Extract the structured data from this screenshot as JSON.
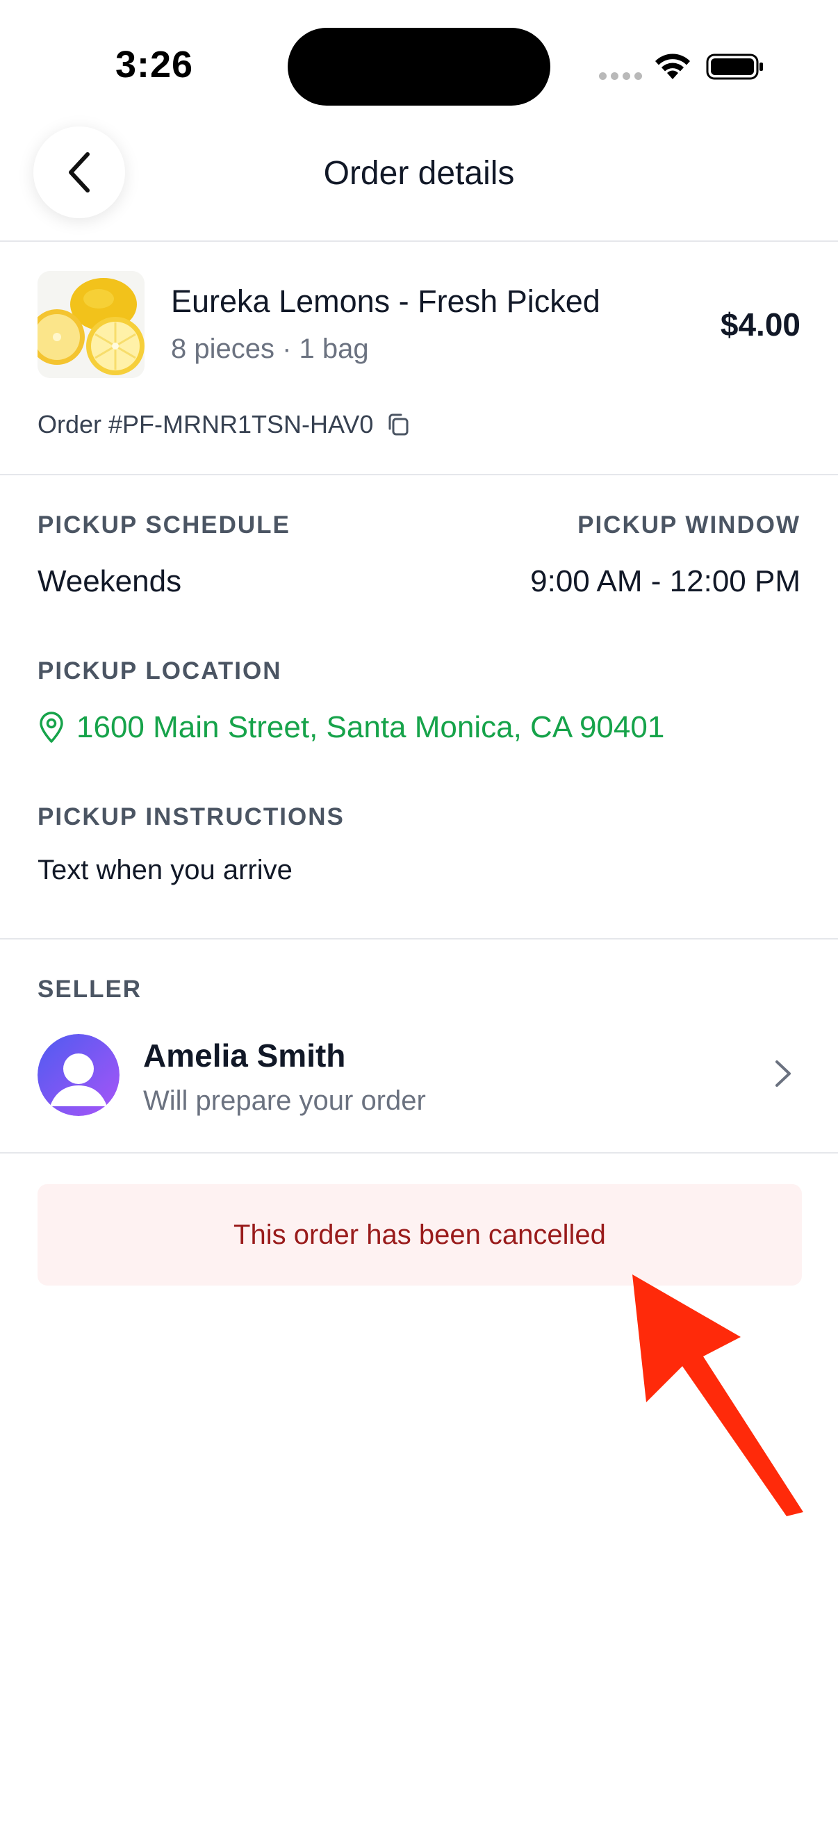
{
  "status_bar": {
    "time": "3:26"
  },
  "nav": {
    "title": "Order details",
    "back_icon": "chevron-left-icon"
  },
  "product": {
    "name": "Eureka Lemons - Fresh Picked",
    "meta": "8 pieces · 1 bag",
    "price": "$4.00",
    "order_number": "Order #PF-MRNR1TSN-HAV0",
    "copy_icon": "copy-icon"
  },
  "pickup": {
    "schedule_label": "PICKUP SCHEDULE",
    "schedule_value": "Weekends",
    "window_label": "PICKUP WINDOW",
    "window_value": "9:00 AM - 12:00 PM",
    "location_label": "PICKUP LOCATION",
    "location_value": "1600 Main Street, Santa Monica, CA 90401",
    "instructions_label": "PICKUP INSTRUCTIONS",
    "instructions_value": "Text when you arrive"
  },
  "seller": {
    "section_label": "SELLER",
    "name": "Amelia Smith",
    "subtitle": "Will prepare your order"
  },
  "banner": {
    "text": "This order has been cancelled"
  },
  "colors": {
    "accent_green": "#16a34a",
    "cancel_bg": "#fef2f2",
    "cancel_text": "#991b1b",
    "annotation_red": "#ff2a0a"
  }
}
